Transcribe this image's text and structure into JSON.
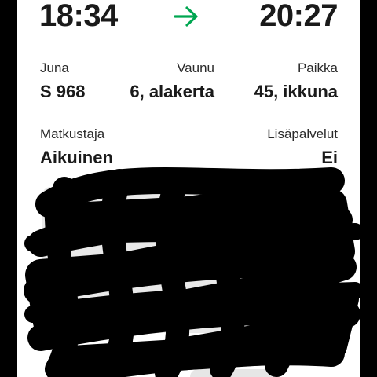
{
  "times": {
    "departure": "18:34",
    "arrival": "20:27"
  },
  "icons": {
    "arrow": "arrow-right-icon"
  },
  "colors": {
    "accent": "#00a651",
    "text": "#1a1a1a",
    "background": "#ffffff"
  },
  "details": {
    "juna_label": "Juna",
    "juna_value": "S 968",
    "vaunu_label": "Vaunu",
    "vaunu_value": "6, alakerta",
    "paikka_label": "Paikka",
    "paikka_value": "45, ikkuna",
    "matkustaja_label": "Matkustaja",
    "matkustaja_value": "Aikuinen",
    "lisapalvelut_label": "Lisäpalvelut",
    "lisapalvelut_value": "Ei"
  }
}
